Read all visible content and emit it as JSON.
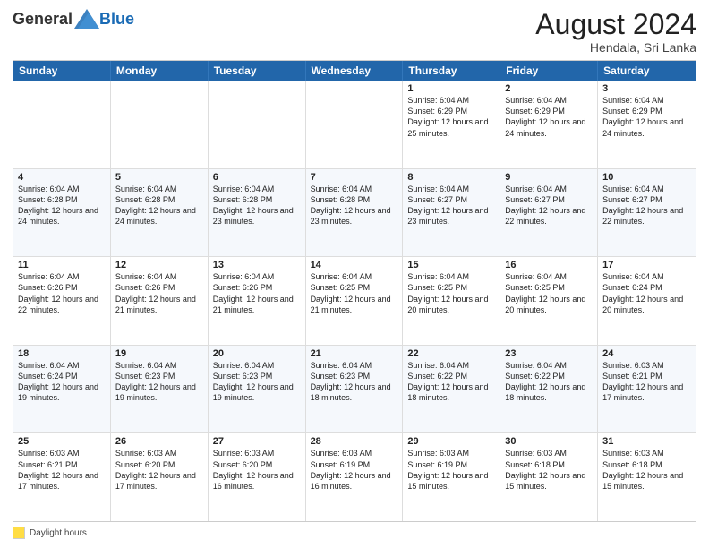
{
  "header": {
    "logo_general": "General",
    "logo_blue": "Blue",
    "month_year": "August 2024",
    "location": "Hendala, Sri Lanka"
  },
  "weekdays": [
    "Sunday",
    "Monday",
    "Tuesday",
    "Wednesday",
    "Thursday",
    "Friday",
    "Saturday"
  ],
  "legend_label": "Daylight hours",
  "weeks": [
    [
      {
        "day": "",
        "info": ""
      },
      {
        "day": "",
        "info": ""
      },
      {
        "day": "",
        "info": ""
      },
      {
        "day": "",
        "info": ""
      },
      {
        "day": "1",
        "info": "Sunrise: 6:04 AM\nSunset: 6:29 PM\nDaylight: 12 hours\nand 25 minutes."
      },
      {
        "day": "2",
        "info": "Sunrise: 6:04 AM\nSunset: 6:29 PM\nDaylight: 12 hours\nand 24 minutes."
      },
      {
        "day": "3",
        "info": "Sunrise: 6:04 AM\nSunset: 6:29 PM\nDaylight: 12 hours\nand 24 minutes."
      }
    ],
    [
      {
        "day": "4",
        "info": "Sunrise: 6:04 AM\nSunset: 6:28 PM\nDaylight: 12 hours\nand 24 minutes."
      },
      {
        "day": "5",
        "info": "Sunrise: 6:04 AM\nSunset: 6:28 PM\nDaylight: 12 hours\nand 24 minutes."
      },
      {
        "day": "6",
        "info": "Sunrise: 6:04 AM\nSunset: 6:28 PM\nDaylight: 12 hours\nand 23 minutes."
      },
      {
        "day": "7",
        "info": "Sunrise: 6:04 AM\nSunset: 6:28 PM\nDaylight: 12 hours\nand 23 minutes."
      },
      {
        "day": "8",
        "info": "Sunrise: 6:04 AM\nSunset: 6:27 PM\nDaylight: 12 hours\nand 23 minutes."
      },
      {
        "day": "9",
        "info": "Sunrise: 6:04 AM\nSunset: 6:27 PM\nDaylight: 12 hours\nand 22 minutes."
      },
      {
        "day": "10",
        "info": "Sunrise: 6:04 AM\nSunset: 6:27 PM\nDaylight: 12 hours\nand 22 minutes."
      }
    ],
    [
      {
        "day": "11",
        "info": "Sunrise: 6:04 AM\nSunset: 6:26 PM\nDaylight: 12 hours\nand 22 minutes."
      },
      {
        "day": "12",
        "info": "Sunrise: 6:04 AM\nSunset: 6:26 PM\nDaylight: 12 hours\nand 21 minutes."
      },
      {
        "day": "13",
        "info": "Sunrise: 6:04 AM\nSunset: 6:26 PM\nDaylight: 12 hours\nand 21 minutes."
      },
      {
        "day": "14",
        "info": "Sunrise: 6:04 AM\nSunset: 6:25 PM\nDaylight: 12 hours\nand 21 minutes."
      },
      {
        "day": "15",
        "info": "Sunrise: 6:04 AM\nSunset: 6:25 PM\nDaylight: 12 hours\nand 20 minutes."
      },
      {
        "day": "16",
        "info": "Sunrise: 6:04 AM\nSunset: 6:25 PM\nDaylight: 12 hours\nand 20 minutes."
      },
      {
        "day": "17",
        "info": "Sunrise: 6:04 AM\nSunset: 6:24 PM\nDaylight: 12 hours\nand 20 minutes."
      }
    ],
    [
      {
        "day": "18",
        "info": "Sunrise: 6:04 AM\nSunset: 6:24 PM\nDaylight: 12 hours\nand 19 minutes."
      },
      {
        "day": "19",
        "info": "Sunrise: 6:04 AM\nSunset: 6:23 PM\nDaylight: 12 hours\nand 19 minutes."
      },
      {
        "day": "20",
        "info": "Sunrise: 6:04 AM\nSunset: 6:23 PM\nDaylight: 12 hours\nand 19 minutes."
      },
      {
        "day": "21",
        "info": "Sunrise: 6:04 AM\nSunset: 6:23 PM\nDaylight: 12 hours\nand 18 minutes."
      },
      {
        "day": "22",
        "info": "Sunrise: 6:04 AM\nSunset: 6:22 PM\nDaylight: 12 hours\nand 18 minutes."
      },
      {
        "day": "23",
        "info": "Sunrise: 6:04 AM\nSunset: 6:22 PM\nDaylight: 12 hours\nand 18 minutes."
      },
      {
        "day": "24",
        "info": "Sunrise: 6:03 AM\nSunset: 6:21 PM\nDaylight: 12 hours\nand 17 minutes."
      }
    ],
    [
      {
        "day": "25",
        "info": "Sunrise: 6:03 AM\nSunset: 6:21 PM\nDaylight: 12 hours\nand 17 minutes."
      },
      {
        "day": "26",
        "info": "Sunrise: 6:03 AM\nSunset: 6:20 PM\nDaylight: 12 hours\nand 17 minutes."
      },
      {
        "day": "27",
        "info": "Sunrise: 6:03 AM\nSunset: 6:20 PM\nDaylight: 12 hours\nand 16 minutes."
      },
      {
        "day": "28",
        "info": "Sunrise: 6:03 AM\nSunset: 6:19 PM\nDaylight: 12 hours\nand 16 minutes."
      },
      {
        "day": "29",
        "info": "Sunrise: 6:03 AM\nSunset: 6:19 PM\nDaylight: 12 hours\nand 15 minutes."
      },
      {
        "day": "30",
        "info": "Sunrise: 6:03 AM\nSunset: 6:18 PM\nDaylight: 12 hours\nand 15 minutes."
      },
      {
        "day": "31",
        "info": "Sunrise: 6:03 AM\nSunset: 6:18 PM\nDaylight: 12 hours\nand 15 minutes."
      }
    ]
  ]
}
